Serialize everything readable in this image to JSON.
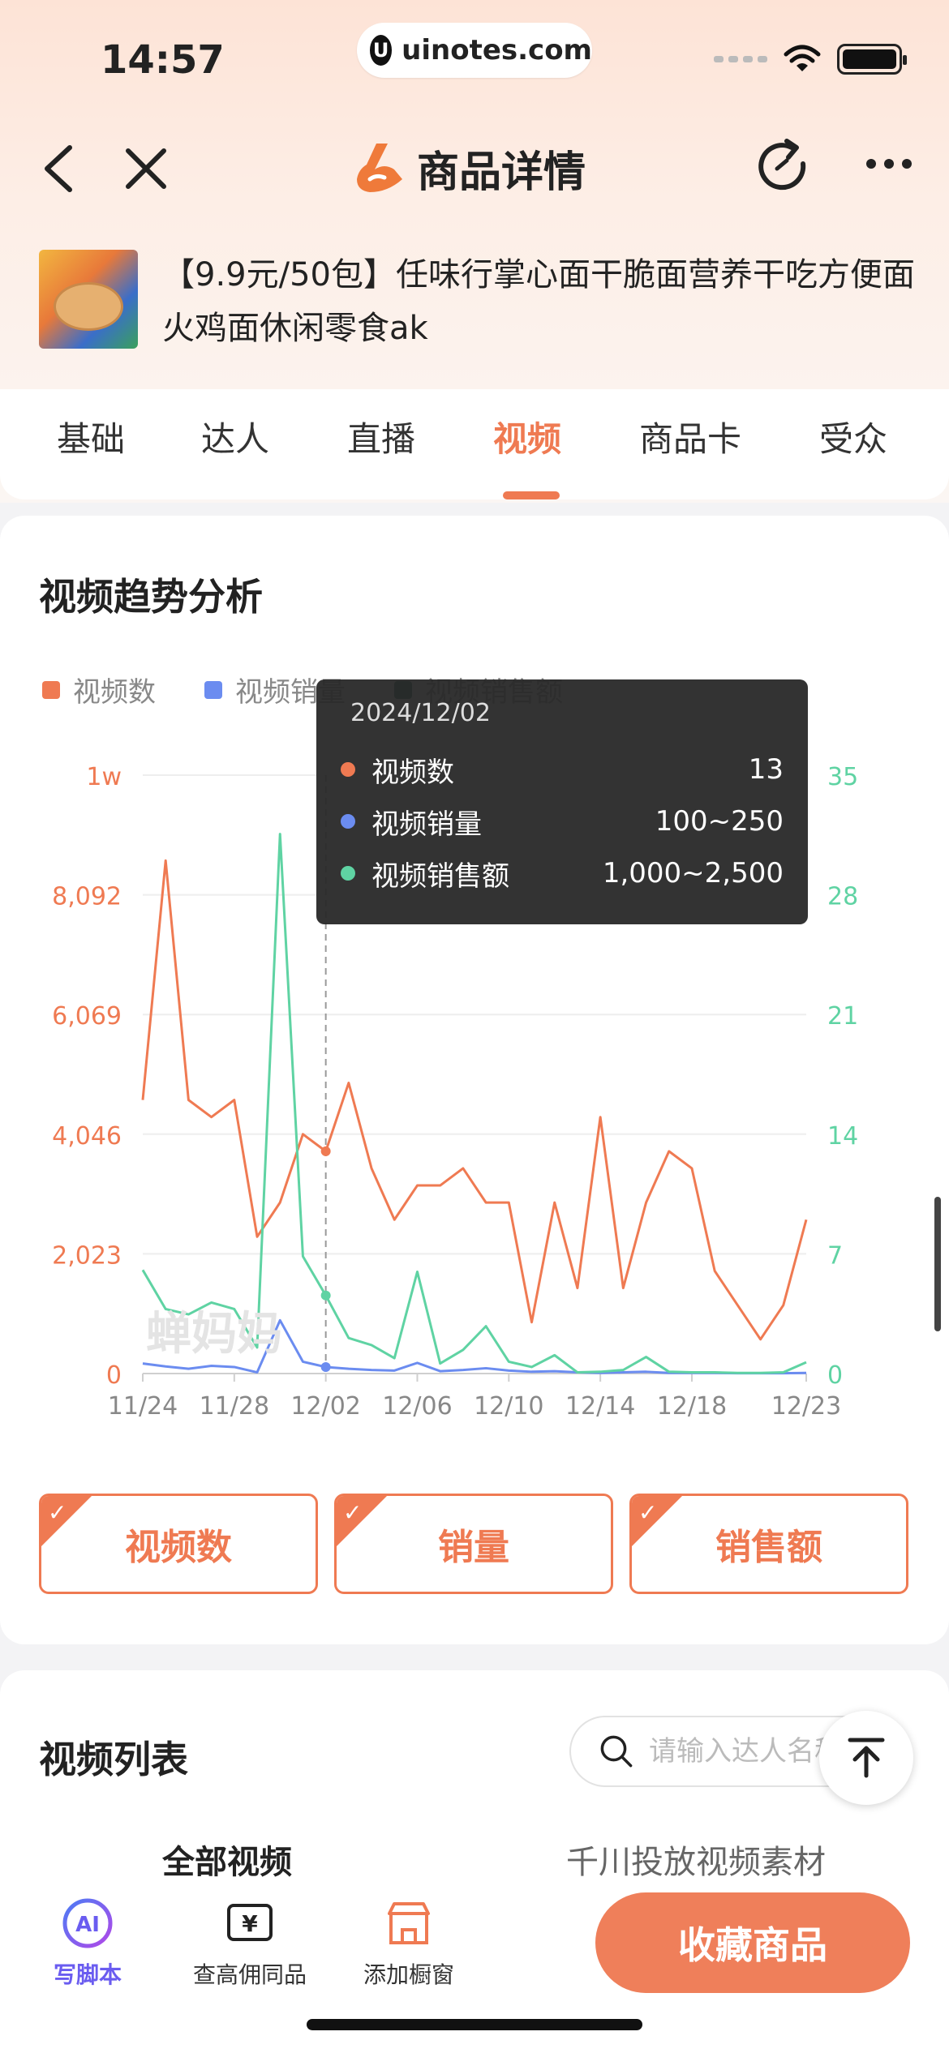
{
  "status": {
    "time": "14:57",
    "url": "uinotes.com"
  },
  "nav": {
    "title": "商品详情"
  },
  "product": {
    "title": "【9.9元/50包】任味行掌心面干脆面营养干吃方便面火鸡面休闲零食ak"
  },
  "tabs": [
    {
      "label": "基础",
      "active": false
    },
    {
      "label": "达人",
      "active": false
    },
    {
      "label": "直播",
      "active": false
    },
    {
      "label": "视频",
      "active": true
    },
    {
      "label": "商品卡",
      "active": false
    },
    {
      "label": "受众",
      "active": false
    }
  ],
  "trend": {
    "title": "视频趋势分析",
    "legend": [
      {
        "name": "视频数",
        "color": "#ef7a52"
      },
      {
        "name": "视频销量",
        "color": "#6b8cf0"
      },
      {
        "name": "视频销售额",
        "color": "#5fd3a3"
      }
    ],
    "watermark": "蝉妈妈",
    "tooltip": {
      "date": "2024/12/02",
      "rows": [
        {
          "name": "视频数",
          "value": "13",
          "color": "#ef7a52"
        },
        {
          "name": "视频销量",
          "value": "100~250",
          "color": "#6b8cf0"
        },
        {
          "name": "视频销售额",
          "value": "1,000~2,500",
          "color": "#5fd3a3"
        }
      ]
    },
    "metric_buttons": [
      "视频数",
      "销量",
      "销售额"
    ]
  },
  "chart_data": {
    "type": "line",
    "x_tick_labels": [
      "11/24",
      "11/28",
      "12/02",
      "12/06",
      "12/10",
      "12/14",
      "12/18",
      "12/23"
    ],
    "x": [
      "11/24",
      "11/25",
      "11/26",
      "11/27",
      "11/28",
      "11/29",
      "11/30",
      "12/01",
      "12/02",
      "12/03",
      "12/04",
      "12/05",
      "12/06",
      "12/07",
      "12/08",
      "12/09",
      "12/10",
      "12/11",
      "12/12",
      "12/13",
      "12/14",
      "12/15",
      "12/16",
      "12/17",
      "12/18",
      "12/19",
      "12/20",
      "12/21",
      "12/22",
      "12/23"
    ],
    "y_left_ticks": [
      "0",
      "2,023",
      "4,046",
      "6,069",
      "8,092",
      "1w"
    ],
    "y_right_ticks": [
      "0",
      "7",
      "14",
      "21",
      "28",
      "35"
    ],
    "y_left_lim": [
      0,
      10115
    ],
    "y_right_lim": [
      0,
      35
    ],
    "series": [
      {
        "name": "视频数",
        "axis": "right",
        "color": "#ef7a52",
        "values": [
          16,
          30,
          16,
          15,
          16,
          8,
          10,
          14,
          13,
          17,
          12,
          9,
          11,
          11,
          12,
          10,
          10,
          3,
          10,
          5,
          15,
          5,
          10,
          13,
          12,
          6,
          4,
          2,
          4,
          9
        ]
      },
      {
        "name": "视频销量",
        "axis": "left",
        "color": "#6b8cf0",
        "values": [
          170,
          120,
          80,
          130,
          110,
          20,
          900,
          200,
          110,
          80,
          60,
          50,
          180,
          40,
          60,
          90,
          50,
          30,
          40,
          20,
          10,
          20,
          30,
          10,
          10,
          10,
          5,
          5,
          5,
          10
        ]
      },
      {
        "name": "视频销售额",
        "axis": "left",
        "color": "#5fd3a3",
        "values": [
          1750,
          1090,
          1000,
          1200,
          1090,
          440,
          9120,
          1980,
          1320,
          600,
          480,
          260,
          1720,
          170,
          400,
          800,
          200,
          110,
          310,
          20,
          30,
          60,
          280,
          30,
          20,
          20,
          10,
          10,
          20,
          190
        ]
      }
    ],
    "hover_index": 8,
    "grid": true,
    "legend_position": "top-left"
  },
  "video_list": {
    "title": "视频列表",
    "search_placeholder": "请输入达人名称",
    "sub_tabs": [
      "全部视频",
      "千川投放视频素材"
    ]
  },
  "bottom_bar": {
    "items": [
      {
        "label": "写脚本",
        "icon": "ai-icon"
      },
      {
        "label": "查高佣同品",
        "icon": "yen-icon"
      },
      {
        "label": "添加橱窗",
        "icon": "shop-icon"
      }
    ],
    "collect_label": "收藏商品"
  }
}
